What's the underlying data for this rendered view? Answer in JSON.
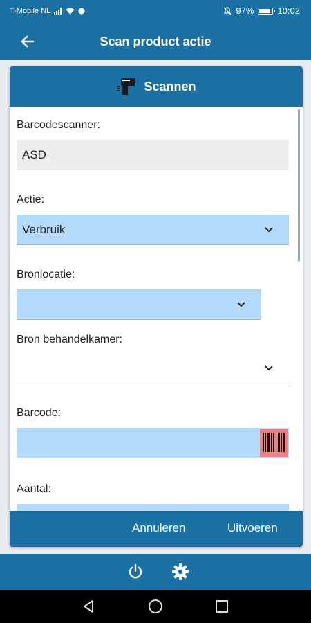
{
  "status": {
    "carrier": "T-Mobile NL",
    "battery": "97%",
    "battery_level": 0.97,
    "time": "10:02"
  },
  "appbar": {
    "title": "Scan product actie",
    "back_icon": "arrow-left-icon"
  },
  "card": {
    "header_label": "Scannen",
    "header_icon": "barcode-scanner-icon",
    "fields": {
      "scanner_label": "Barcodescanner:",
      "scanner_value": "ASD",
      "action_label": "Actie:",
      "action_value": "Verbruik",
      "source_label": "Bronlocatie:",
      "source_value": "",
      "room_label": "Bron behandelkamer:",
      "room_value": "",
      "barcode_label": "Barcode:",
      "barcode_value": "",
      "quantity_label": "Aantal:"
    },
    "footer": {
      "cancel": "Annuleren",
      "execute": "Uitvoeren"
    }
  },
  "bottombar": {
    "icons": [
      "power-icon",
      "gear-icon"
    ]
  },
  "navbar": {
    "icons": [
      "back-triangle-icon",
      "home-circle-icon",
      "recents-square-icon"
    ]
  },
  "colors": {
    "primary": "#1a6fa3",
    "field_blue": "#b3d9fb",
    "field_grey": "#eeeeee"
  }
}
